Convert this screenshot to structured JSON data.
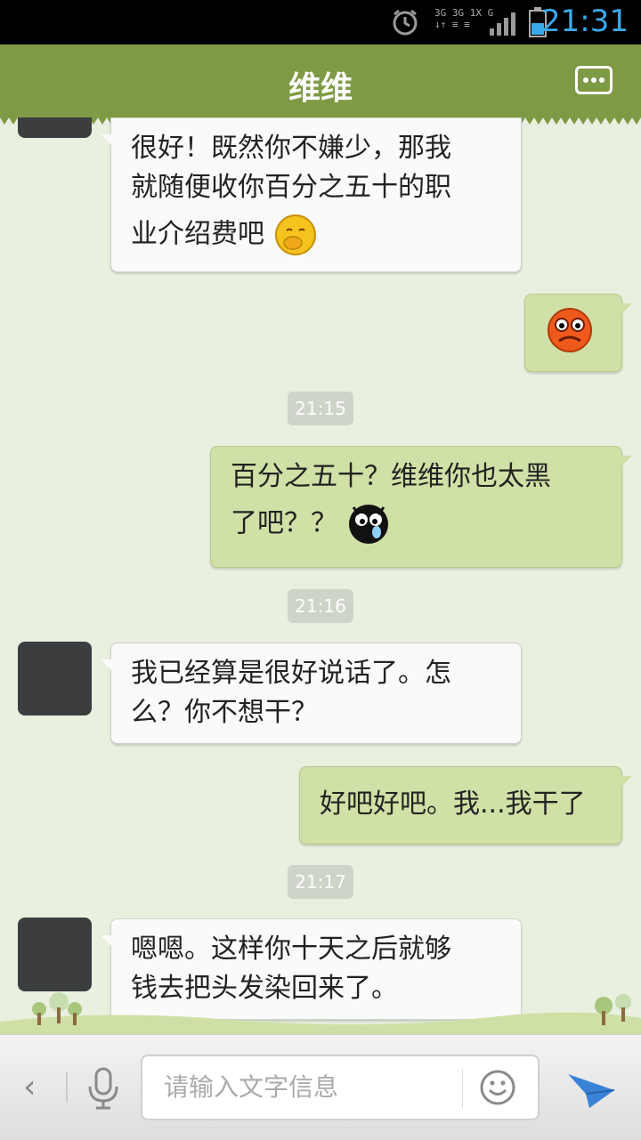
{
  "status": {
    "time": "21:31",
    "network_top": "3G 3G 1X G",
    "network_bottom": "↓↑ ≡ ≡"
  },
  "header": {
    "title": "维维"
  },
  "messages": [
    {
      "side": "in",
      "text_line1": "很好！既然你不嫌少，那我",
      "text_line2": "就随便收你百分之五十的职",
      "text_line3": "业介绍费吧"
    },
    {
      "side": "out",
      "emoji": "angry-face"
    },
    {
      "time": "21:15"
    },
    {
      "side": "out",
      "text_line1": "百分之五十？维维你也太黑",
      "text_line2": "了吧？？"
    },
    {
      "time": "21:16"
    },
    {
      "side": "in",
      "text_line1": "我已经算是很好说话了。怎",
      "text_line2": "么？你不想干？"
    },
    {
      "side": "out",
      "text_line1": "好吧好吧。我...我干了"
    },
    {
      "time": "21:17"
    },
    {
      "side": "in",
      "text_line1": "嗯嗯。这样你十天之后就够",
      "text_line2": "钱去把头发染回来了。"
    }
  ],
  "input": {
    "placeholder": "请输入文字信息"
  },
  "colors": {
    "header": "#7e9a45",
    "out_bubble": "#cfe1a6",
    "in_bubble": "#fafafa",
    "background": "#e9f0e0",
    "send": "#3a82d8"
  }
}
